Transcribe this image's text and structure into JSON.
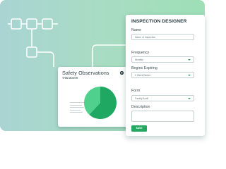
{
  "observations_card": {
    "title": "Safety Observations",
    "subtitle": "THIS MONTH",
    "icon": "gear-icon"
  },
  "chart_data": {
    "type": "pie",
    "values": [
      0.62,
      0.38
    ],
    "colors": [
      "#1fa862",
      "#4fd18d"
    ]
  },
  "inspection_designer": {
    "title": "INSPECTION DESIGNER",
    "name_label": "Name",
    "name_value": "Name of Inspection",
    "frequency_label": "Frequency",
    "frequency_value": "Monthly",
    "begins_expiring_label": "Begins Expiring",
    "begins_expiring_value": "2 Week Before",
    "form_label": "Form",
    "form_value": "Facility Audit",
    "description_label": "Description",
    "description_value": "",
    "save_label": "SAVE"
  },
  "colors": {
    "accent": "#26a862",
    "background_gradient_start": "#a9d4d3",
    "background_gradient_end": "#9edfb7"
  }
}
